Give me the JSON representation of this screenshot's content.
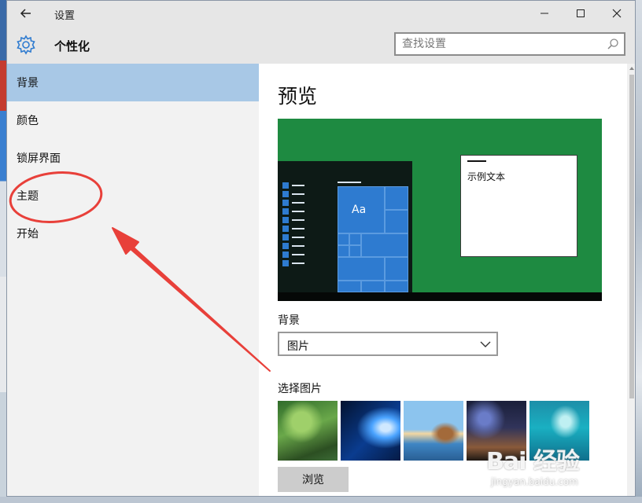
{
  "window": {
    "title": "设置"
  },
  "titlebar": {
    "controls": [
      "minimize",
      "maximize",
      "close"
    ]
  },
  "header": {
    "icon": "gear-icon",
    "title": "个性化",
    "search": {
      "placeholder": "查找设置",
      "value": ""
    }
  },
  "sidebar": {
    "items": [
      {
        "label": "背景",
        "selected": true
      },
      {
        "label": "颜色",
        "selected": false
      },
      {
        "label": "锁屏界面",
        "selected": false
      },
      {
        "label": "主题",
        "selected": false
      },
      {
        "label": "开始",
        "selected": false
      }
    ]
  },
  "preview": {
    "title": "预览",
    "sample_text": "示例文本",
    "tile_text": "Aa"
  },
  "background": {
    "label": "背景",
    "selected": "图片"
  },
  "choose_picture": {
    "label": "选择图片",
    "thumbnails": [
      "forest-waterfall",
      "windows-blue-light",
      "beach-rock-arch",
      "night-sky-milkyway",
      "underwater-swimmer"
    ]
  },
  "browse": {
    "label": "浏览"
  },
  "watermark": {
    "logo": "Bai 经验",
    "url": "jingyan.baidu.com"
  },
  "colors": {
    "accent": "#2e7bd0",
    "selected_nav": "#a8c8e6",
    "preview_green": "#1e8a41",
    "annotation_red": "#e8403a"
  }
}
